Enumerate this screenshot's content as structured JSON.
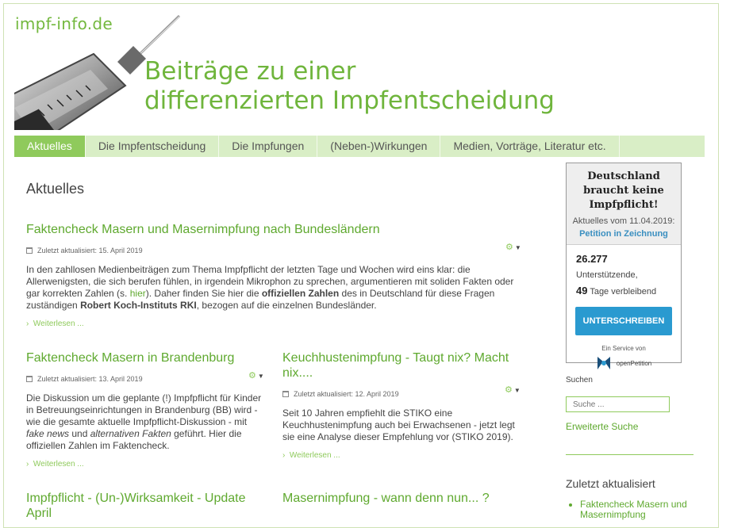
{
  "site": {
    "name": "impf-info.de",
    "tagline_line1": "Beiträge zu einer",
    "tagline_line2": "differenzierten Impfentscheidung"
  },
  "nav": {
    "items": [
      {
        "label": "Aktuelles",
        "active": true
      },
      {
        "label": "Die Impfentscheidung"
      },
      {
        "label": "Die Impfungen"
      },
      {
        "label": "(Neben-)Wirkungen"
      },
      {
        "label": "Medien, Vorträge, Literatur etc."
      }
    ]
  },
  "main": {
    "page_title": "Aktuelles",
    "articles": [
      {
        "title": "Faktencheck Masern und Masernimpfung nach Bundesländern",
        "meta": "Zuletzt aktualisiert: 15. April 2019",
        "text_1": "In den zahllosen Medienbeiträgen zum Thema Impfpflicht der letzten Tage und Wochen wird eins klar: die Allerwenigsten, die sich berufen fühlen, in irgendein Mikrophon zu sprechen, argumentieren mit soliden Fakten oder gar korrekten Zahlen (s. ",
        "link": "hier",
        "text_2": "). Daher finden Sie hier die ",
        "bold_1": "offiziellen Zahlen",
        "text_3": " des in Deutschland für diese Fragen zuständigen ",
        "bold_2": "Robert Koch-Instituts RKI",
        "text_4": ", bezogen auf die einzelnen Bundesländer.",
        "more": "Weiterlesen ..."
      },
      {
        "title": "Faktencheck Masern in Brandenburg",
        "meta": "Zuletzt aktualisiert: 13. April 2019",
        "text_1": "Die Diskussion um die geplante (!) Impfpflicht für Kinder in Betreuungseinrichtungen in Brandenburg (BB) wird - wie die gesamte aktuelle Impfpflicht-Diskussion - mit ",
        "italic_1": "fake news",
        "text_2": " und ",
        "italic_2": "alternativen Fakten",
        "text_3": " geführt. Hier die offiziellen Zahlen im Faktencheck.",
        "more": "Weiterlesen ..."
      },
      {
        "title": "Keuchhustenimpfung - Taugt nix? Macht nix....",
        "meta": "Zuletzt aktualisiert: 12. April 2019",
        "text": "Seit 10 Jahren empfiehlt die STIKO eine Keuchhustenimpfung auch bei Erwachsenen - jetzt legt sie eine Analyse dieser Empfehlung vor (STIKO 2019).",
        "more": "Weiterlesen ..."
      },
      {
        "title": "Impfpflicht - (Un-)Wirksamkeit - Update April"
      },
      {
        "title": "Masernimpfung - wann denn nun... ?"
      }
    ]
  },
  "petition": {
    "title": "Deutschland braucht keine Impfpflicht!",
    "date": "Aktuelles vom 11.04.2019:",
    "status": "Petition in Zeichnung",
    "supporters": "26.277",
    "supporters_label": " Unterstützende,",
    "days": "49",
    "days_label": " Tage verbleibend",
    "button": "UNTERSCHREIBEN",
    "service": "Ein Service von",
    "logo_text": "openPetition"
  },
  "sidebar": {
    "search_label": "Suchen",
    "search_placeholder": "Suche ...",
    "advanced_search": "Erweiterte Suche",
    "recent_title": "Zuletzt aktualisiert",
    "recent_items": [
      "Faktencheck Masern und Masernimpfung"
    ]
  },
  "icons": [
    "calendar-icon",
    "gear-icon",
    "chevron-right-icon",
    "openpetition-logo"
  ],
  "colors": {
    "accent_green": "#73b83e",
    "nav_bg": "#d9eec6",
    "nav_active": "#8fca5c",
    "petition_button": "#2a9ad0"
  }
}
